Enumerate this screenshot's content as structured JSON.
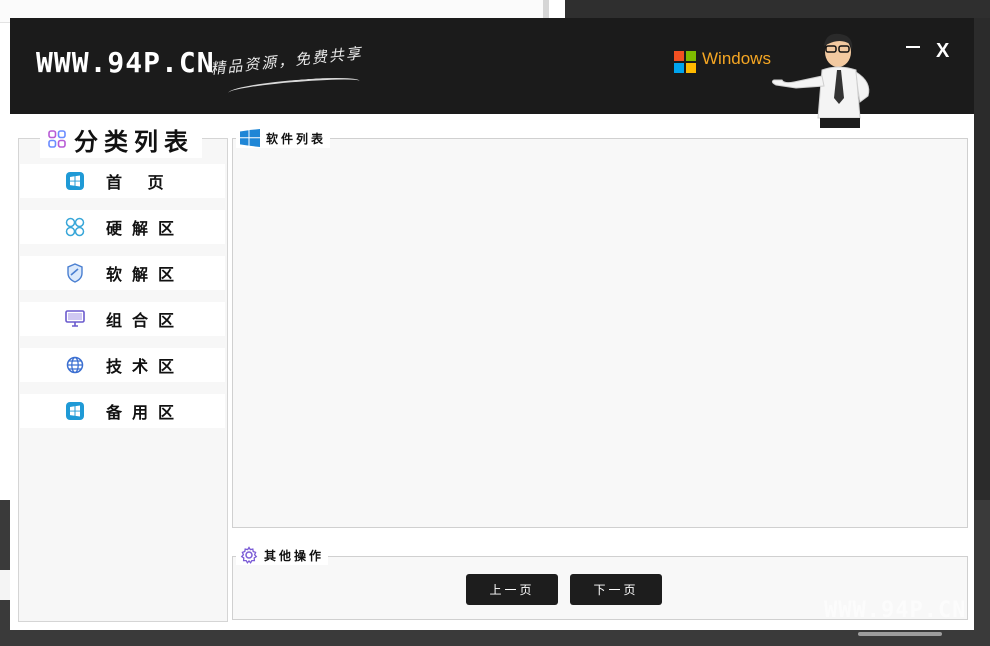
{
  "window": {
    "brand": "WWW.94P.CN",
    "tagline": "精品资源，免费共享",
    "windows_label": "Windows",
    "close_label": "X"
  },
  "sidebar": {
    "title": "分类列表",
    "items": [
      {
        "label": "首 页",
        "icon": "windows-icon"
      },
      {
        "label": "硬解区",
        "icon": "grid-icon"
      },
      {
        "label": "软解区",
        "icon": "shield-icon"
      },
      {
        "label": "组合区",
        "icon": "monitor-icon"
      },
      {
        "label": "技术区",
        "icon": "globe-icon"
      },
      {
        "label": "备用区",
        "icon": "windows-icon"
      }
    ]
  },
  "software": {
    "legend": "软件列表"
  },
  "ops": {
    "legend": "其他操作",
    "prev_label": "上一页",
    "next_label": "下一页"
  },
  "watermark": "WWW.94P.CN",
  "colors": {
    "titlebar": "#1b1b1b",
    "accent_blue": "#1f9ad6",
    "button": "#1d1d1d"
  }
}
